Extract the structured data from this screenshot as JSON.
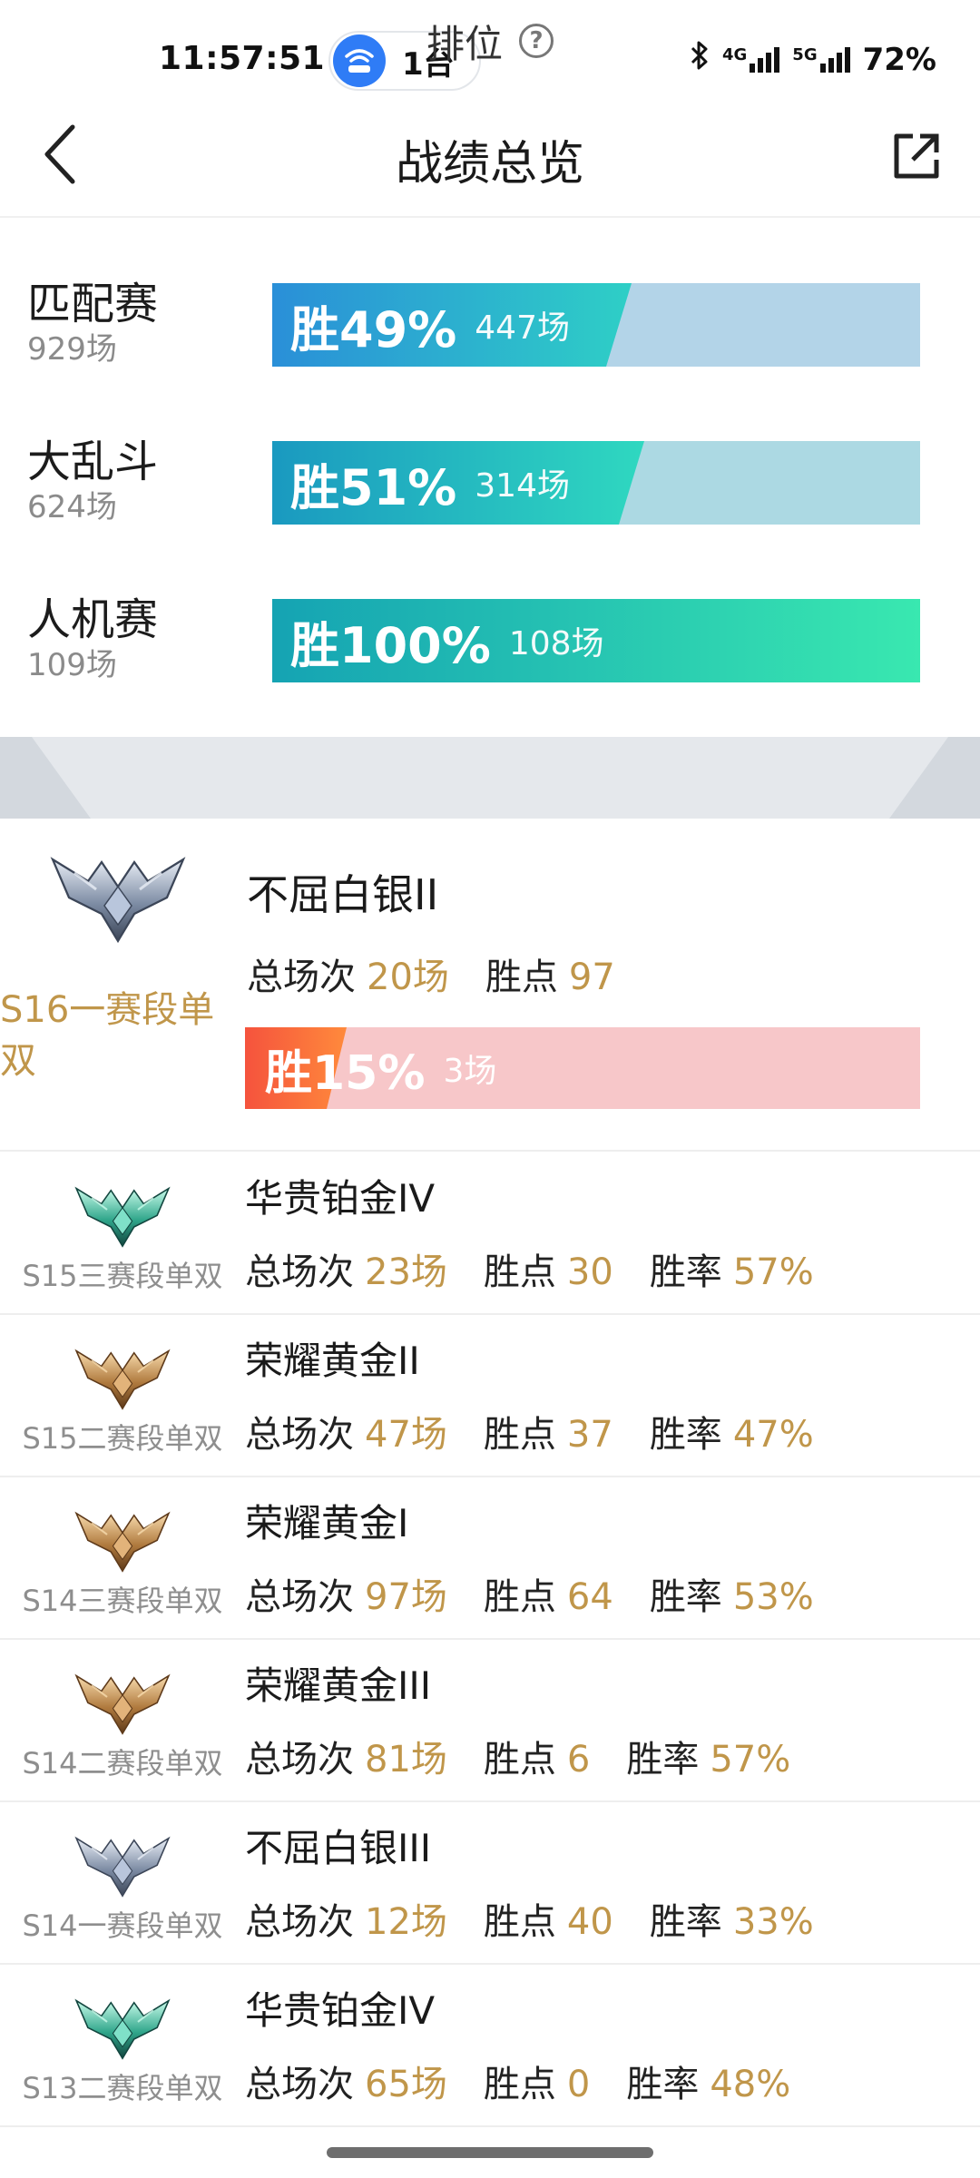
{
  "status_bar": {
    "time": "11:57:51",
    "device_count": "1台",
    "battery": "72%",
    "net_4g": "4G",
    "net_5g": "5G"
  },
  "header": {
    "title": "战绩总览"
  },
  "modes": [
    {
      "name": "匹配赛",
      "count": "929场",
      "win_label": "胜49%",
      "win_games": "447场",
      "win_rate": 0.49,
      "colors": [
        "#2a8fd8",
        "#2ecfc6"
      ],
      "track": "#b3d4e8"
    },
    {
      "name": "大乱斗",
      "count": "624场",
      "win_label": "胜51%",
      "win_games": "314场",
      "win_rate": 0.51,
      "colors": [
        "#1a99c0",
        "#2fd8c0"
      ],
      "track": "#acd9e3"
    },
    {
      "name": "人机赛",
      "count": "109场",
      "win_label": "胜100%",
      "win_games": "108场",
      "win_rate": 1.0,
      "colors": [
        "#15a3b3",
        "#39e8b0"
      ],
      "track": "#bfeee0"
    }
  ],
  "ranked": {
    "title": "排位",
    "help_icon": "question-circle-icon",
    "current": {
      "season": "S16一赛段单双",
      "tier": "不屈白银II",
      "total_label": "总场次",
      "total": "20场",
      "points_label": "胜点",
      "points": "97",
      "win_label": "胜15%",
      "win_games": "3场",
      "win_rate": 0.15,
      "emblem": "silver"
    },
    "history": [
      {
        "season": "S15三赛段单双",
        "tier": "华贵铂金IV",
        "total_label": "总场次",
        "total": "23场",
        "points_label": "胜点",
        "points": "30",
        "rate_label": "胜率",
        "rate": "57%",
        "emblem": "platinum"
      },
      {
        "season": "S15二赛段单双",
        "tier": "荣耀黄金II",
        "total_label": "总场次",
        "total": "47场",
        "points_label": "胜点",
        "points": "37",
        "rate_label": "胜率",
        "rate": "47%",
        "emblem": "gold"
      },
      {
        "season": "S14三赛段单双",
        "tier": "荣耀黄金I",
        "total_label": "总场次",
        "total": "97场",
        "points_label": "胜点",
        "points": "64",
        "rate_label": "胜率",
        "rate": "53%",
        "emblem": "gold"
      },
      {
        "season": "S14二赛段单双",
        "tier": "荣耀黄金III",
        "total_label": "总场次",
        "total": "81场",
        "points_label": "胜点",
        "points": "6",
        "rate_label": "胜率",
        "rate": "57%",
        "emblem": "gold"
      },
      {
        "season": "S14一赛段单双",
        "tier": "不屈白银III",
        "total_label": "总场次",
        "total": "12场",
        "points_label": "胜点",
        "points": "40",
        "rate_label": "胜率",
        "rate": "33%",
        "emblem": "silver"
      },
      {
        "season": "S13二赛段单双",
        "tier": "华贵铂金IV",
        "total_label": "总场次",
        "total": "65场",
        "points_label": "胜点",
        "points": "0",
        "rate_label": "胜率",
        "rate": "48%",
        "emblem": "platinum"
      }
    ]
  }
}
